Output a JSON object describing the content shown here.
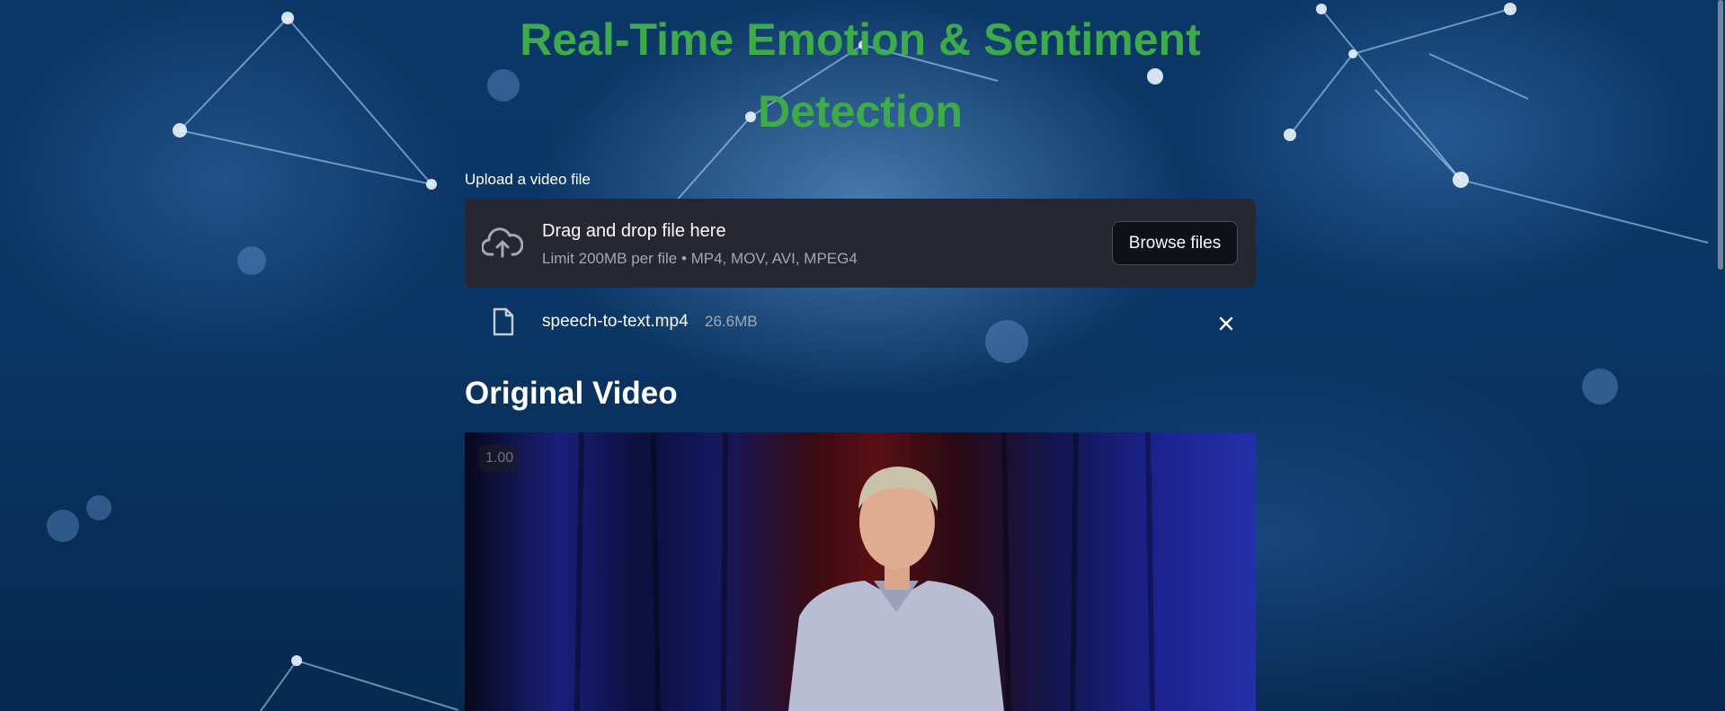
{
  "header": {
    "title": "Real-Time Emotion & Sentiment Detection",
    "title_color": "#3dab4a"
  },
  "uploader": {
    "label": "Upload a video file",
    "drop_title": "Drag and drop file here",
    "drop_limits": "Limit 200MB per file • MP4, MOV, AVI, MPEG4",
    "browse_label": "Browse files",
    "icon": "cloud-upload-icon"
  },
  "uploaded_file": {
    "name": "speech-to-text.mp4",
    "size": "26.6MB",
    "icon": "file-icon",
    "remove_icon": "close-icon"
  },
  "video_section": {
    "title": "Original Video",
    "playback_speed": "1.00"
  },
  "colors": {
    "panel_bg": "#262730",
    "button_bg": "#0e1117",
    "muted_text": "#a3a8b4"
  }
}
